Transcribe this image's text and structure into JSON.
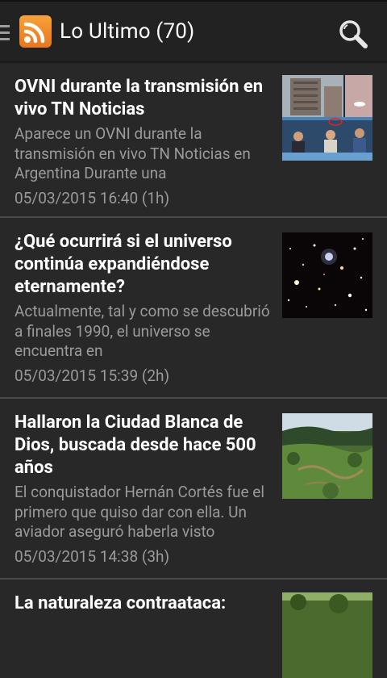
{
  "header": {
    "title": "Lo Ultimo (70)",
    "accent": "#f39c2b"
  },
  "feed": [
    {
      "title": "OVNI durante la transmisión en vivo TN Noticias",
      "summary": "Aparece un OVNI durante la transmisión en vivo TN Noticias en Argentina Durante una",
      "date": "05/03/2015 16:40 (1h)",
      "thumbnail": "tv-news-studio"
    },
    {
      "title": "¿Qué ocurrirá si el universo continúa expandiéndose eternamente?",
      "summary": "Actualmente, tal y como se descubrió a finales 1990, el universo se encuentra en",
      "date": "05/03/2015 15:39 (2h)",
      "thumbnail": "starfield"
    },
    {
      "title": "Hallaron la Ciudad Blanca de Dios, buscada desde hace 500 años",
      "summary": "El conquistador Hernán Cortés fue el primero que quiso dar con ella. Un aviador aseguró haberla visto",
      "date": "05/03/2015 14:38 (3h)",
      "thumbnail": "jungle-landscape"
    },
    {
      "title": "La naturaleza contraataca:",
      "summary": "",
      "date": "",
      "thumbnail": "vegetation"
    }
  ]
}
